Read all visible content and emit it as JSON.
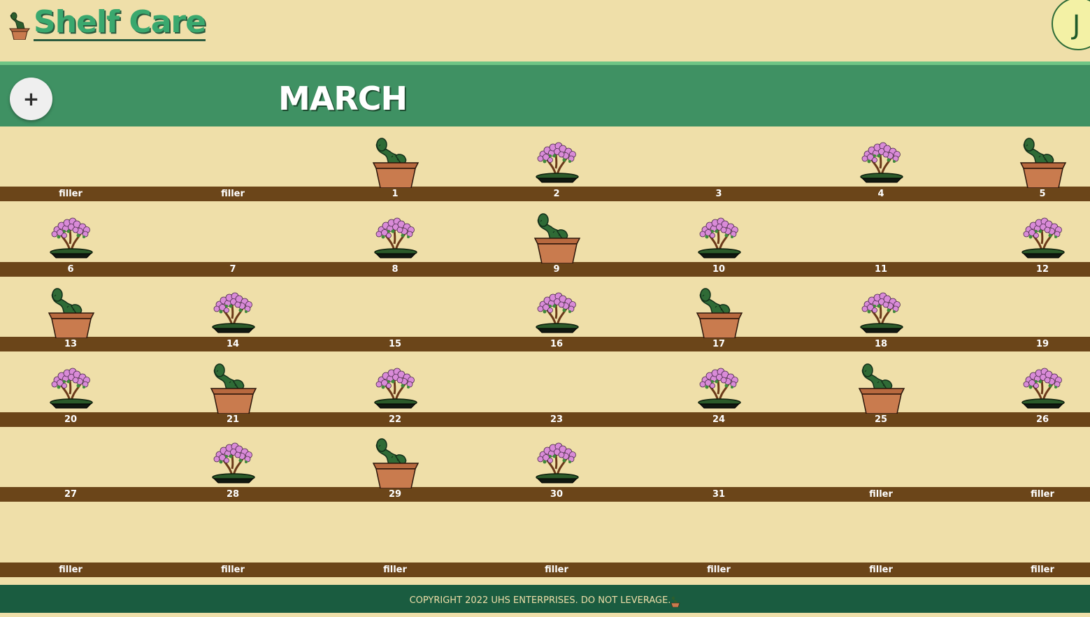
{
  "app": {
    "title": "Shelf Care"
  },
  "user": {
    "initial": "J"
  },
  "toolbar": {
    "add_label": "+"
  },
  "calendar": {
    "month": "MARCH",
    "weeks": [
      [
        {
          "label": "filler",
          "plant": "none"
        },
        {
          "label": "filler",
          "plant": "none"
        },
        {
          "label": "1",
          "plant": "cactus"
        },
        {
          "label": "2",
          "plant": "bonsai"
        },
        {
          "label": "3",
          "plant": "none"
        },
        {
          "label": "4",
          "plant": "bonsai"
        },
        {
          "label": "5",
          "plant": "cactus"
        }
      ],
      [
        {
          "label": "6",
          "plant": "bonsai"
        },
        {
          "label": "7",
          "plant": "none"
        },
        {
          "label": "8",
          "plant": "bonsai"
        },
        {
          "label": "9",
          "plant": "cactus"
        },
        {
          "label": "10",
          "plant": "bonsai"
        },
        {
          "label": "11",
          "plant": "none"
        },
        {
          "label": "12",
          "plant": "bonsai"
        }
      ],
      [
        {
          "label": "13",
          "plant": "cactus"
        },
        {
          "label": "14",
          "plant": "bonsai"
        },
        {
          "label": "15",
          "plant": "none"
        },
        {
          "label": "16",
          "plant": "bonsai"
        },
        {
          "label": "17",
          "plant": "cactus"
        },
        {
          "label": "18",
          "plant": "bonsai"
        },
        {
          "label": "19",
          "plant": "none"
        }
      ],
      [
        {
          "label": "20",
          "plant": "bonsai"
        },
        {
          "label": "21",
          "plant": "cactus"
        },
        {
          "label": "22",
          "plant": "bonsai"
        },
        {
          "label": "23",
          "plant": "none"
        },
        {
          "label": "24",
          "plant": "bonsai"
        },
        {
          "label": "25",
          "plant": "cactus"
        },
        {
          "label": "26",
          "plant": "bonsai"
        }
      ],
      [
        {
          "label": "27",
          "plant": "none"
        },
        {
          "label": "28",
          "plant": "bonsai"
        },
        {
          "label": "29",
          "plant": "cactus"
        },
        {
          "label": "30",
          "plant": "bonsai"
        },
        {
          "label": "31",
          "plant": "none"
        },
        {
          "label": "filler",
          "plant": "none"
        },
        {
          "label": "filler",
          "plant": "none"
        }
      ],
      [
        {
          "label": "filler",
          "plant": "none"
        },
        {
          "label": "filler",
          "plant": "none"
        },
        {
          "label": "filler",
          "plant": "none"
        },
        {
          "label": "filler",
          "plant": "none"
        },
        {
          "label": "filler",
          "plant": "none"
        },
        {
          "label": "filler",
          "plant": "none"
        },
        {
          "label": "filler",
          "plant": "none"
        }
      ]
    ]
  },
  "footer": {
    "text": "COPYRIGHT 2022 UHS ENTERPRISES. DO NOT LEVERAGE."
  },
  "colors": {
    "background": "#efdfa9",
    "month_bar": "#3f9163",
    "shelf": "#6b4519",
    "footer": "#1a5c40",
    "brand": "#3aa86e"
  },
  "icons": {
    "logo": "potted-cactus-icon",
    "plant_types": [
      "cactus-plant-icon",
      "bonsai-plant-icon"
    ]
  }
}
